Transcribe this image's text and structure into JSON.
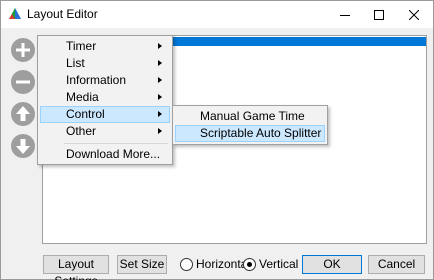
{
  "window": {
    "title": "Layout Editor"
  },
  "side_buttons": [
    {
      "icon": "plus-icon"
    },
    {
      "icon": "minus-icon"
    },
    {
      "icon": "arrow-up-icon"
    },
    {
      "icon": "arrow-down-icon"
    }
  ],
  "menu": {
    "items": [
      {
        "label": "Timer",
        "has_submenu": true
      },
      {
        "label": "List",
        "has_submenu": true
      },
      {
        "label": "Information",
        "has_submenu": true
      },
      {
        "label": "Media",
        "has_submenu": true
      },
      {
        "label": "Control",
        "has_submenu": true,
        "active": true
      },
      {
        "label": "Other",
        "has_submenu": true
      },
      {
        "label": "Download More...",
        "has_submenu": false
      }
    ]
  },
  "submenu": {
    "items": [
      {
        "label": "Manual Game Time"
      },
      {
        "label": "Scriptable Auto Splitter",
        "active": true
      }
    ]
  },
  "footer": {
    "layout_settings_label": "Layout Settings",
    "set_size_label": "Set Size",
    "horizontal_label": "Horizontal",
    "vertical_label": "Vertical",
    "orientation_selected": "Vertical",
    "ok_label": "OK",
    "cancel_label": "Cancel"
  },
  "colors": {
    "selection": "#0078d7",
    "menu_highlight": "#cce8ff",
    "side_button_disabled": "#9e9e9e"
  }
}
